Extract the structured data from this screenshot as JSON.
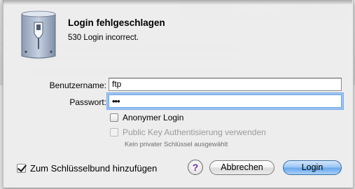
{
  "dialog": {
    "title": "Login fehlgeschlagen",
    "message": "530 Login incorrect.",
    "icon": "network-drive-icon"
  },
  "form": {
    "username_label": "Benutzername:",
    "username_value": "ftp",
    "password_label": "Passwort:",
    "password_value": "•••",
    "anonymous_label": "Anonymer Login",
    "anonymous_checked": false,
    "public_key_label": "Public Key Authentisierung verwenden",
    "public_key_checked": false,
    "public_key_enabled": false,
    "public_key_hint": "Kein privater Schlüssel ausgewählt"
  },
  "footer": {
    "keychain_label": "Zum Schlüsselbund hinzufügen",
    "keychain_checked": true,
    "help_label": "?",
    "cancel_label": "Abbrechen",
    "login_label": "Login"
  },
  "colors": {
    "focus_ring": "#9cc3f2",
    "default_button": "#6aa9ec",
    "help_question": "#6b2c91"
  }
}
